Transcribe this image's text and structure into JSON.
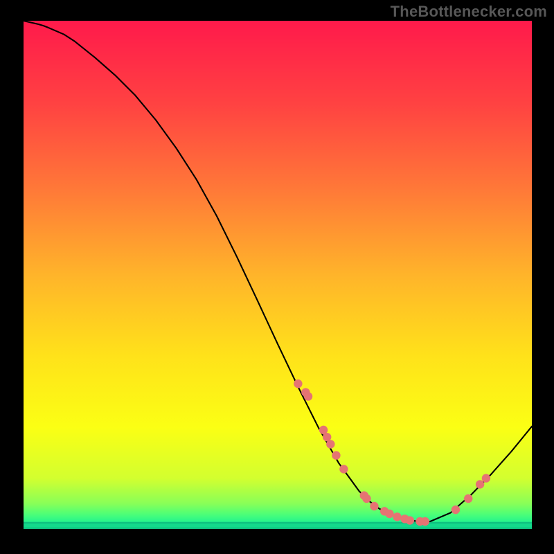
{
  "watermark": "TheBottlenecker.com",
  "chart_data": {
    "type": "line",
    "title": "",
    "xlabel": "",
    "ylabel": "",
    "xlim": [
      0,
      100
    ],
    "ylim": [
      0,
      100
    ],
    "grid": false,
    "series": [
      {
        "name": "curve",
        "x": [
          0,
          3,
          4,
          5,
          8,
          10,
          14,
          18,
          22,
          26,
          30,
          34,
          38,
          42,
          46,
          50,
          54,
          58,
          62,
          66,
          68,
          70,
          72,
          74,
          76,
          78,
          80,
          84,
          88,
          92,
          96,
          100
        ],
        "values": [
          100,
          99.3,
          99.0,
          98.6,
          97.3,
          96.0,
          92.8,
          89.3,
          85.3,
          80.5,
          75.0,
          68.8,
          61.6,
          53.5,
          45.0,
          36.4,
          28.0,
          20.0,
          13.0,
          7.5,
          5.5,
          4.0,
          3.0,
          2.2,
          1.7,
          1.5,
          1.5,
          3.2,
          6.7,
          10.8,
          15.3,
          20.2
        ]
      }
    ],
    "scatter_points": {
      "name": "markers",
      "color": "#e57373",
      "x": [
        54,
        55.5,
        56,
        59,
        59.7,
        60.4,
        61.5,
        63,
        67,
        67.5,
        69,
        71,
        72,
        73.5,
        75,
        76,
        78,
        79,
        85,
        87.5,
        89.8,
        91
      ],
      "y": [
        28.6,
        26.9,
        26.1,
        19.5,
        18.1,
        16.7,
        14.5,
        11.8,
        6.6,
        6.0,
        4.5,
        3.5,
        3.0,
        2.4,
        2.0,
        1.7,
        1.5,
        1.5,
        3.8,
        6.0,
        8.8,
        10.0
      ]
    },
    "background": {
      "type": "vertical-gradient",
      "stops": [
        {
          "offset": 0,
          "color": "#ff1a4b"
        },
        {
          "offset": 16,
          "color": "#ff4142"
        },
        {
          "offset": 33,
          "color": "#ff7838"
        },
        {
          "offset": 50,
          "color": "#ffb42a"
        },
        {
          "offset": 66,
          "color": "#ffe21a"
        },
        {
          "offset": 80,
          "color": "#fbff14"
        },
        {
          "offset": 90,
          "color": "#d3ff2f"
        },
        {
          "offset": 95,
          "color": "#88ff58"
        },
        {
          "offset": 97,
          "color": "#4fff76"
        },
        {
          "offset": 99,
          "color": "#1af293"
        },
        {
          "offset": 100,
          "color": "#10d88c"
        }
      ]
    },
    "bottom_band": {
      "color_outer": "#0fbf7f",
      "color_inner": "#13d98b",
      "height_pct": 1.4
    }
  }
}
